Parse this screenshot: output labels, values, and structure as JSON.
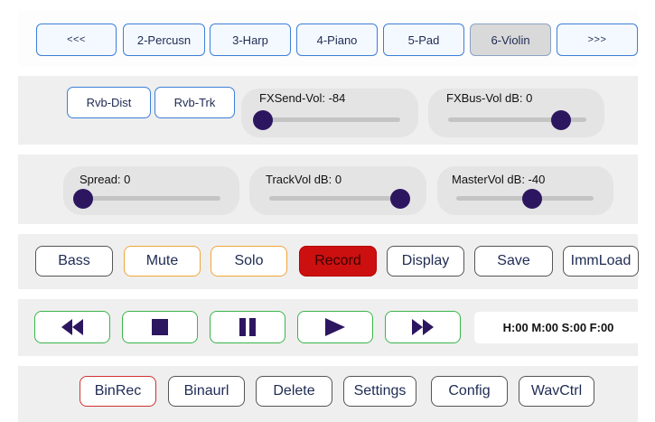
{
  "tracks": {
    "prev_label": "<<<",
    "next_label": ">>>",
    "items": [
      {
        "label": "2-Percusn"
      },
      {
        "label": "3-Harp"
      },
      {
        "label": "4-Piano"
      },
      {
        "label": "5-Pad"
      },
      {
        "label": "6-Violin",
        "active": true
      }
    ]
  },
  "reverb": {
    "rvb_dist_label": "Rvb-Dist",
    "rvb_trk_label": "Rvb-Trk",
    "fxsend": {
      "label": "FXSend-Vol: -84",
      "level": 0.0
    },
    "fxbus": {
      "label": "FXBus-Vol dB: 0",
      "level": 0.82
    }
  },
  "mix": {
    "spread": {
      "label": "Spread: 0",
      "level": 0.0
    },
    "trackvol": {
      "label": "TrackVol dB: 0",
      "level": 0.95
    },
    "mastervol": {
      "label": "MasterVol dB: -40",
      "level": 0.55
    }
  },
  "controls": {
    "bass_label": "Bass",
    "mute_label": "Mute",
    "solo_label": "Solo",
    "record_label": "Record",
    "display_label": "Display",
    "save_label": "Save",
    "immload_label": "ImmLoad"
  },
  "transport": {
    "timecode": "H:00 M:00 S:00 F:00"
  },
  "tools": {
    "binrec_label": "BinRec",
    "binaurl_label": "Binaurl",
    "delete_label": "Delete",
    "settings_label": "Settings",
    "config_label": "Config",
    "wavctrl_label": "WavCtrl"
  },
  "colors": {
    "accent_blue": "#3d7fd9",
    "transport_green": "#3ab54a",
    "record_red": "#cc1010",
    "thumb": "#2d1660"
  }
}
